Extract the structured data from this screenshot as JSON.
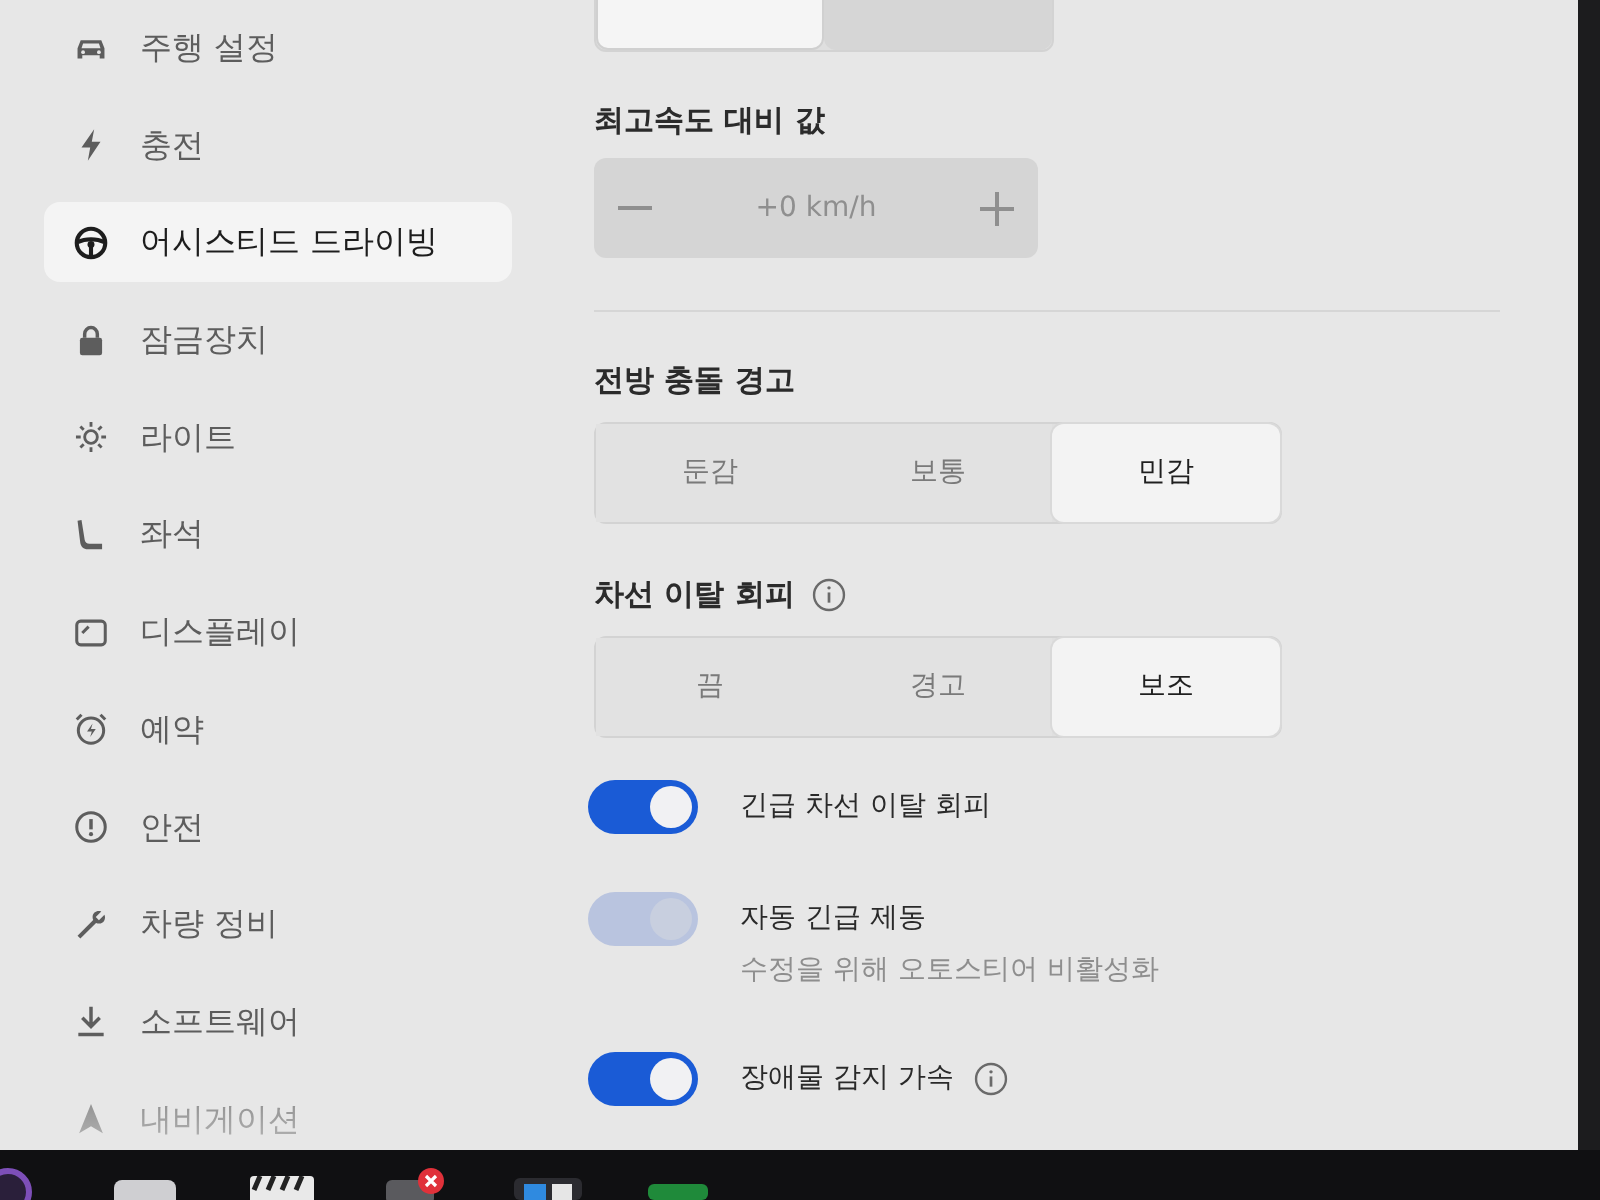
{
  "sidebar": {
    "items": [
      {
        "label": "주행 설정",
        "selected": false
      },
      {
        "label": "충전",
        "selected": false
      },
      {
        "label": "어시스티드 드라이빙",
        "selected": true
      },
      {
        "label": "잠금장치",
        "selected": false
      },
      {
        "label": "라이트",
        "selected": false
      },
      {
        "label": "좌석",
        "selected": false
      },
      {
        "label": "디스플레이",
        "selected": false
      },
      {
        "label": "예약",
        "selected": false
      },
      {
        "label": "안전",
        "selected": false
      },
      {
        "label": "차량 정비",
        "selected": false
      },
      {
        "label": "소프트웨어",
        "selected": false
      },
      {
        "label": "내비게이션",
        "selected": false
      }
    ]
  },
  "speed_limit_mode": {
    "disabled": true,
    "options": [
      {
        "selected": true
      },
      {
        "selected": false
      }
    ]
  },
  "speed_offset": {
    "label": "최고속도 대비 값",
    "value": "+0 km/h",
    "disabled": true
  },
  "forward_collision_warning": {
    "label": "전방 충돌 경고",
    "options": [
      {
        "label": "둔감",
        "selected": false
      },
      {
        "label": "보통",
        "selected": false
      },
      {
        "label": "민감",
        "selected": true
      }
    ]
  },
  "lane_departure_avoidance": {
    "label": "차선 이탈 회피",
    "info": true,
    "options": [
      {
        "label": "끔",
        "selected": false
      },
      {
        "label": "경고",
        "selected": false
      },
      {
        "label": "보조",
        "selected": true
      }
    ]
  },
  "toggles": [
    {
      "label": "긴급 차선 이탈 회피",
      "on": true,
      "disabled": false
    },
    {
      "label": "자동 긴급 제동",
      "on": true,
      "disabled": true,
      "description": "수정을 위해 오토스티어 비활성화"
    },
    {
      "label": "장애물 감지 가속",
      "on": true,
      "disabled": false,
      "info": true
    }
  ]
}
